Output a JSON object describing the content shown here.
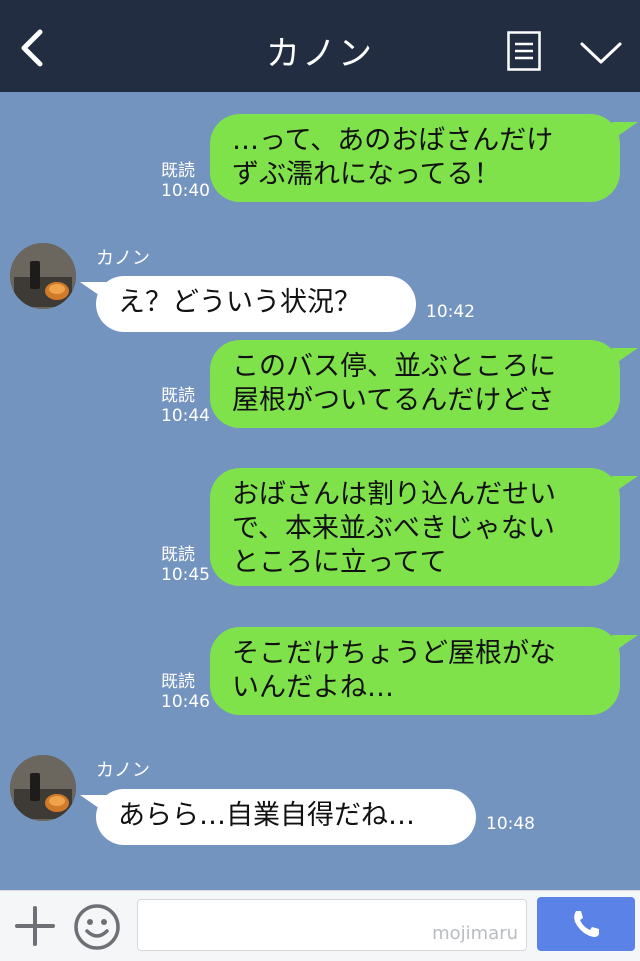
{
  "header": {
    "title": "カノン"
  },
  "messages": [
    {
      "side": "me",
      "text": "…って、あのおばさんだけ\nずぶ濡れになってる！",
      "read_label": "既読",
      "time": "10:40"
    },
    {
      "side": "them",
      "sender": "カノン",
      "text": "え？どういう状況？",
      "time": "10:42"
    },
    {
      "side": "me",
      "text": "このバス停、並ぶところに\n屋根がついてるんだけどさ",
      "read_label": "既読",
      "time": "10:44"
    },
    {
      "side": "me",
      "text": "おばさんは割り込んだせい\nで、本来並ぶべきじゃない\nところに立ってて",
      "read_label": "既読",
      "time": "10:45"
    },
    {
      "side": "me",
      "text": "そこだけちょうど屋根がな\nいんだよね…",
      "read_label": "既読",
      "time": "10:46"
    },
    {
      "side": "them",
      "sender": "カノン",
      "text": "あらら…自業自得だね…",
      "time": "10:48"
    }
  ],
  "footer": {
    "input_value": "",
    "watermark": "mojimaru"
  },
  "colors": {
    "background": "#7494c0",
    "header": "#232d42",
    "my_bubble": "#80e24a",
    "their_bubble": "#ffffff",
    "call_button": "#5b82e6"
  }
}
